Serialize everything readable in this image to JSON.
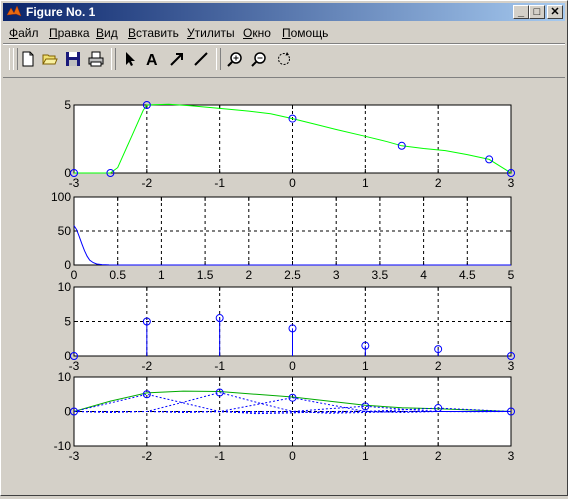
{
  "window": {
    "title": "Figure No. 1",
    "minimize_glyph": "_",
    "maximize_glyph": "□",
    "close_glyph": "✕"
  },
  "menu": [
    {
      "id": "file",
      "accel": "Ф",
      "rest": "айл"
    },
    {
      "id": "edit",
      "accel": "П",
      "rest": "равка"
    },
    {
      "id": "view",
      "accel": "В",
      "rest": "ид"
    },
    {
      "id": "insert",
      "accel": "В",
      "rest": "ставить"
    },
    {
      "id": "tools",
      "accel": "У",
      "rest": "тилиты"
    },
    {
      "id": "window",
      "accel": "О",
      "rest": "кно"
    },
    {
      "id": "help",
      "accel": "П",
      "rest": "омощь"
    }
  ],
  "toolbar_icons": [
    "new-file-icon",
    "open-folder-icon",
    "save-icon",
    "print-icon",
    "select-arrow-icon",
    "insert-text-icon",
    "insert-arrow-icon",
    "insert-line-icon",
    "zoom-in-icon",
    "zoom-out-icon",
    "rotate-icon"
  ],
  "colors": {
    "curve": "#00ff00",
    "marker": "#0000ff",
    "axes_bg": "#ffffff",
    "figure_bg": "#cccccc"
  },
  "chart_data": [
    {
      "type": "line",
      "xlim": [
        -3,
        3
      ],
      "ylim": [
        0,
        5
      ],
      "xticks": [
        "-3",
        "-2",
        "-1",
        "0",
        "1",
        "2",
        "3"
      ],
      "yticks": [
        "0",
        "5"
      ],
      "grid": true,
      "series": [
        {
          "style": "line",
          "color": "#00ff00",
          "x": [
            -3,
            -2.5,
            -2.4,
            -2.2,
            -2.05,
            -2,
            -1.7,
            -1.4,
            -1,
            -0.6,
            -0.3,
            0,
            0.3,
            0.6,
            1,
            1.3,
            1.5,
            1.8,
            2.1,
            2.4,
            2.7,
            2.85,
            3
          ],
          "y": [
            0,
            0,
            0.4,
            2.8,
            4.6,
            5,
            5.05,
            4.95,
            4.75,
            4.55,
            4.35,
            4,
            3.6,
            3.2,
            2.7,
            2.3,
            2,
            1.8,
            1.65,
            1.35,
            1,
            0.5,
            0
          ]
        },
        {
          "style": "marker",
          "marker": "o",
          "color": "#0000ff",
          "x": [
            -3,
            -2.5,
            -2,
            0,
            1.5,
            2.7,
            3
          ],
          "y": [
            0,
            0,
            5,
            4,
            2,
            1,
            0
          ]
        }
      ]
    },
    {
      "type": "line",
      "xlim": [
        0,
        5
      ],
      "ylim": [
        0,
        100
      ],
      "xticks": [
        "0",
        "0.5",
        "1",
        "1.5",
        "2",
        "2.5",
        "3",
        "3.5",
        "4",
        "4.5",
        "5"
      ],
      "yticks": [
        "0",
        "50",
        "100"
      ],
      "grid": true,
      "series": [
        {
          "style": "line",
          "color": "#0000ff",
          "x": [
            0,
            0.03,
            0.06,
            0.09,
            0.12,
            0.15,
            0.18,
            0.22,
            0.26,
            0.32,
            0.4,
            0.5,
            1,
            5
          ],
          "y": [
            58,
            52,
            42,
            31,
            21,
            13,
            7,
            3.5,
            1.5,
            0.6,
            0.2,
            0,
            0,
            0
          ]
        }
      ]
    },
    {
      "type": "stem",
      "xlim": [
        -3,
        3
      ],
      "ylim": [
        0,
        10
      ],
      "xticks": [
        "-3",
        "-2",
        "-1",
        "0",
        "1",
        "2",
        "3"
      ],
      "yticks": [
        "0",
        "5",
        "10"
      ],
      "grid": true,
      "series": [
        {
          "style": "stem",
          "marker": "o",
          "color": "#0000ff",
          "x": [
            -3,
            -2,
            -1,
            0,
            1,
            2,
            3
          ],
          "y": [
            0,
            5,
            5.5,
            4,
            1.5,
            1,
            0
          ]
        }
      ]
    },
    {
      "type": "line",
      "xlim": [
        -3,
        3
      ],
      "ylim": [
        -10,
        10
      ],
      "xticks": [
        "-3",
        "-2",
        "-1",
        "0",
        "1",
        "2",
        "3"
      ],
      "yticks": [
        "-10",
        "0",
        "10"
      ],
      "grid": true,
      "series": [
        {
          "style": "line",
          "color": "#00aa00",
          "x": [
            -3,
            -2.5,
            -2,
            -1.5,
            -1,
            -0.5,
            0,
            0.5,
            1,
            1.5,
            2,
            2.5,
            3
          ],
          "y": [
            0,
            3,
            5.4,
            5.9,
            5.8,
            5,
            4.2,
            3,
            1.8,
            1.1,
            0.8,
            0.4,
            0
          ]
        },
        {
          "style": "dashed",
          "color": "#0000ff",
          "x": [
            -3,
            -2.5,
            -2,
            -1.5,
            -1,
            -0.5,
            0,
            0.5,
            1,
            1.5,
            2,
            2.5,
            3
          ],
          "y": [
            0,
            2.5,
            5,
            2.5,
            0,
            -0.6,
            -0.4,
            0,
            0.1,
            0,
            0,
            0,
            0
          ]
        },
        {
          "style": "dashed",
          "color": "#0000ff",
          "x": [
            -3,
            -2.5,
            -2,
            -1.5,
            -1,
            -0.5,
            0,
            0.5,
            1,
            1.5,
            2,
            2.5,
            3
          ],
          "y": [
            0,
            -0.3,
            0,
            2.7,
            5.5,
            2.7,
            0,
            -0.5,
            -0.3,
            0,
            0,
            0,
            0
          ]
        },
        {
          "style": "dashed",
          "color": "#0000ff",
          "x": [
            -3,
            -2.5,
            -2,
            -1.5,
            -1,
            -0.5,
            0,
            0.5,
            1,
            1.5,
            2,
            2.5,
            3
          ],
          "y": [
            0,
            0,
            0,
            -0.3,
            0,
            2,
            4,
            2,
            0,
            -0.3,
            0,
            0,
            0
          ]
        },
        {
          "style": "dashed",
          "color": "#0000ff",
          "x": [
            -3,
            -2.5,
            -2,
            -1.5,
            -1,
            -0.5,
            0,
            0.5,
            1,
            1.5,
            2,
            2.5,
            3
          ],
          "y": [
            0,
            0,
            0,
            0,
            -0.1,
            -0.2,
            0,
            0.8,
            1.5,
            0.7,
            0,
            -0.1,
            0
          ]
        },
        {
          "style": "dashed",
          "color": "#0000ff",
          "x": [
            -3,
            -2.5,
            -2,
            -1.5,
            -1,
            -0.5,
            0,
            0.5,
            1,
            1.5,
            2,
            2.5,
            3
          ],
          "y": [
            0,
            0,
            0,
            0,
            0,
            0,
            -0.1,
            -0.2,
            0,
            0.5,
            1,
            0.5,
            0
          ]
        },
        {
          "style": "marker",
          "marker": "o",
          "color": "#0000ff",
          "x": [
            -3,
            -2,
            -1,
            0,
            1,
            2,
            3
          ],
          "y": [
            0,
            5,
            5.5,
            4,
            1.5,
            1,
            0
          ]
        }
      ]
    }
  ]
}
